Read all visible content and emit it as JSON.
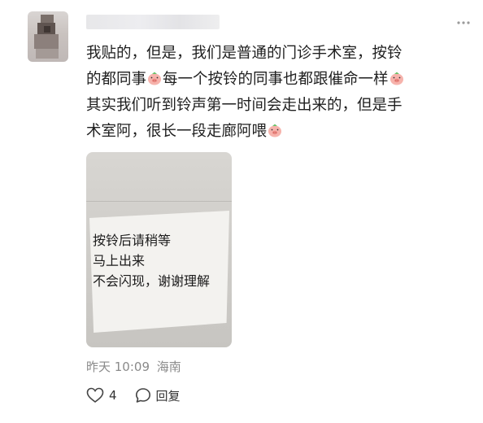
{
  "post": {
    "lines": [
      "我贴的，但是，我们是普通的门诊手术室，按铃",
      "的都同事",
      "每一个按铃的同事也都跟催命一样",
      "其实我们听到铃声第一时间会走出来的，但是手",
      "术室阿，很长一段走廊阿喂"
    ],
    "emoji_icon": "pig-face-emoji"
  },
  "photo": {
    "note_lines": [
      "按铃后请稍等",
      "马上出来",
      "不会闪现，谢谢理解"
    ]
  },
  "meta": {
    "time": "昨天 10:09",
    "location": "海南"
  },
  "actions": {
    "like_count": "4",
    "reply_label": "回复"
  },
  "more_button": "more-horizontal-icon"
}
